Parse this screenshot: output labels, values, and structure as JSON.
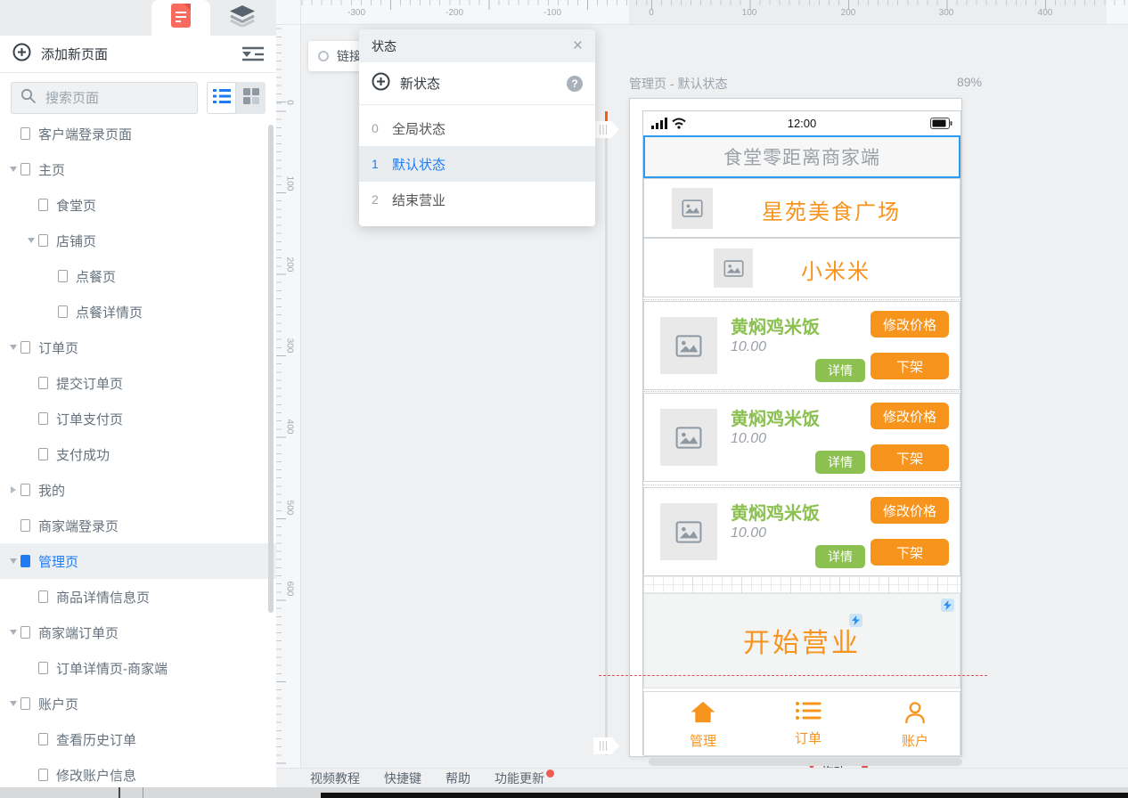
{
  "sidebar": {
    "add_page_label": "添加新页面",
    "search_placeholder": "搜索页面",
    "icons": [
      "pages-tab-icon",
      "layers-tab-icon",
      "add-circle-icon",
      "collapse-all-icon",
      "search-icon",
      "list-view-icon",
      "grid-view-icon"
    ],
    "tree": [
      {
        "label": "客户端登录页面",
        "level": 1,
        "arrow": "none",
        "selected": false
      },
      {
        "label": "主页",
        "level": 1,
        "arrow": "down",
        "selected": false
      },
      {
        "label": "食堂页",
        "level": 2,
        "arrow": "none",
        "selected": false
      },
      {
        "label": "店铺页",
        "level": 2,
        "arrow": "down",
        "selected": false
      },
      {
        "label": "点餐页",
        "level": 3,
        "arrow": "none",
        "selected": false
      },
      {
        "label": "点餐详情页",
        "level": 3,
        "arrow": "none",
        "selected": false
      },
      {
        "label": "订单页",
        "level": 1,
        "arrow": "down",
        "selected": false
      },
      {
        "label": "提交订单页",
        "level": 2,
        "arrow": "none",
        "selected": false
      },
      {
        "label": "订单支付页",
        "level": 2,
        "arrow": "none",
        "selected": false
      },
      {
        "label": "支付成功",
        "level": 2,
        "arrow": "none",
        "selected": false
      },
      {
        "label": "我的",
        "level": 1,
        "arrow": "right",
        "selected": false
      },
      {
        "label": "商家端登录页",
        "level": 1,
        "arrow": "none",
        "selected": false
      },
      {
        "label": "管理页",
        "level": 1,
        "arrow": "down",
        "selected": true
      },
      {
        "label": "商品详情信息页",
        "level": 2,
        "arrow": "none",
        "selected": false
      },
      {
        "label": "商家端订单页",
        "level": 1,
        "arrow": "down",
        "selected": false
      },
      {
        "label": "订单详情页-商家端",
        "level": 2,
        "arrow": "none",
        "selected": false
      },
      {
        "label": "账户页",
        "level": 1,
        "arrow": "down",
        "selected": false
      },
      {
        "label": "查看历史订单",
        "level": 2,
        "arrow": "none",
        "selected": false
      },
      {
        "label": "修改账户信息",
        "level": 2,
        "arrow": "none",
        "selected": false
      }
    ]
  },
  "states_panel": {
    "title": "状态",
    "new_state_label": "新状态",
    "items": [
      {
        "index": "0",
        "label": "全局状态",
        "selected": false
      },
      {
        "index": "1",
        "label": "默认状态",
        "selected": true
      },
      {
        "index": "2",
        "label": "结束营业",
        "selected": false
      }
    ]
  },
  "canvas": {
    "link_chip_label": "链接",
    "page_header": "管理页 - 默认状态",
    "zoom_level": "89%",
    "top_ruler_labels": [
      "-300",
      "-200",
      "-100",
      "0",
      "100",
      "200",
      "300",
      "400"
    ],
    "left_ruler_labels": [
      "0",
      "100",
      "200",
      "300",
      "400",
      "500",
      "600"
    ]
  },
  "phone": {
    "status_time": "12:00",
    "app_title": "食堂零距离商家端",
    "stores": [
      {
        "name": "星苑美食广场"
      },
      {
        "name": "小米米"
      }
    ],
    "foods": [
      {
        "name": "黄焖鸡米饭",
        "price": "10.00",
        "detail_label": "详情",
        "modify_label": "修改价格",
        "off_label": "下架"
      },
      {
        "name": "黄焖鸡米饭",
        "price": "10.00",
        "detail_label": "详情",
        "modify_label": "修改价格",
        "off_label": "下架"
      },
      {
        "name": "黄焖鸡米饭",
        "price": "10.00",
        "detail_label": "详情",
        "modify_label": "修改价格",
        "off_label": "下架"
      }
    ],
    "start_business_label": "开始营业",
    "nav_items": [
      {
        "label": "管理",
        "icon": "home-icon"
      },
      {
        "label": "订单",
        "icon": "orders-icon"
      },
      {
        "label": "账户",
        "icon": "account-icon"
      }
    ],
    "drag_hint": "拖动···"
  },
  "footer": {
    "links": [
      "视频教程",
      "快捷键",
      "帮助",
      "功能更新"
    ],
    "update_badge": true
  },
  "colors": {
    "accent_orange": "#F7941E",
    "green": "#8CC152",
    "selection_blue": "#2B9CF2",
    "highlight_blue": "#1F7BF4",
    "marker_orange": "#F2600A",
    "guide_red": "#E05252",
    "tab_red": "#F96B5F"
  }
}
